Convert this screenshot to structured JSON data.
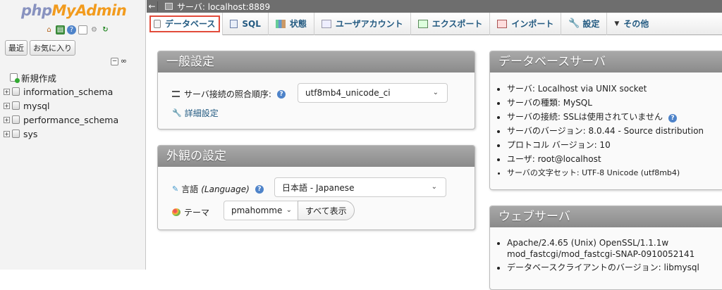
{
  "nav": {
    "logo_php": "php",
    "logo_my": "My",
    "logo_admin": "Admin",
    "recent_label": "最近",
    "favorites_label": "お気に入り",
    "new_label": "新規作成",
    "databases": [
      "information_schema",
      "mysql",
      "performance_schema",
      "sys"
    ]
  },
  "topbar": {
    "server_label": "サーバ: localhost:8889"
  },
  "tabs": [
    {
      "label": "データベース",
      "icon": "database-icon"
    },
    {
      "label": "SQL",
      "icon": "sql-icon"
    },
    {
      "label": "状態",
      "icon": "status-icon"
    },
    {
      "label": "ユーザアカウント",
      "icon": "users-icon"
    },
    {
      "label": "エクスポート",
      "icon": "export-icon"
    },
    {
      "label": "インポート",
      "icon": "import-icon"
    },
    {
      "label": "設定",
      "icon": "wrench-icon"
    },
    {
      "label": "その他",
      "icon": "caret-down-icon"
    }
  ],
  "general": {
    "title": "一般設定",
    "collation_label": "サーバ接続の照合順序:",
    "collation_value": "utf8mb4_unicode_ci",
    "more_settings": "詳細設定"
  },
  "appearance": {
    "title": "外観の設定",
    "language_label": "言語",
    "language_label_en": "(Language)",
    "language_value": "日本語 - Japanese",
    "theme_label": "テーマ",
    "theme_value": "pmahomme",
    "view_all": "すべて表示"
  },
  "db_server": {
    "title": "データベースサーバ",
    "items": [
      "サーバ: Localhost via UNIX socket",
      "サーバの種類: MySQL",
      "サーバの接続: SSLは使用されていません",
      "サーバのバージョン: 8.0.44 - Source distribution",
      "プロトコル バージョン: 10",
      "ユーザ: root@localhost",
      "サーバの文字セット: UTF-8 Unicode (utf8mb4)"
    ]
  },
  "web_server": {
    "title": "ウェブサーバ",
    "items": [
      "Apache/2.4.65 (Unix) OpenSSL/1.1.1w",
      "mod_fastcgi/mod_fastcgi-SNAP-0910052141",
      "データベースクライアントのバージョン: libmysql"
    ]
  },
  "colors": {
    "highlight": "#e24b3b",
    "link": "#235a81",
    "panel_header": "#999999"
  }
}
